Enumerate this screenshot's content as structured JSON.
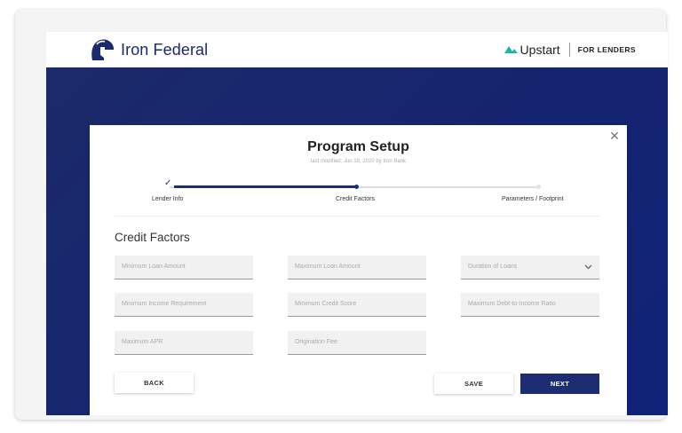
{
  "header": {
    "brand_name": "Iron Federal",
    "brand_icon": "spartan-helmet-icon",
    "partner_name": "Upstart",
    "partner_icon": "upstart-logo-icon",
    "partner_tagline": "FOR LENDERS"
  },
  "modal": {
    "title": "Program Setup",
    "subtitle": "last modified: Jun 19, 2020 by Iron Bank",
    "close_icon": "close-icon"
  },
  "stepper": {
    "steps": [
      {
        "label": "Lender Info",
        "status": "complete"
      },
      {
        "label": "Credit Factors",
        "status": "active"
      },
      {
        "label": "Parameters / Footprint",
        "status": "pending"
      }
    ],
    "progress_fraction": 0.5
  },
  "section": {
    "title": "Credit Factors"
  },
  "fields": {
    "min_loan_amount": {
      "placeholder": "Minimum Loan Amount",
      "value": ""
    },
    "max_loan_amount": {
      "placeholder": "Maximum Loan Amount",
      "value": ""
    },
    "duration_of_loans": {
      "placeholder": "Duration of Loans",
      "value": "",
      "type": "select"
    },
    "min_income": {
      "placeholder": "Minimum Income Requirement",
      "value": ""
    },
    "min_credit_score": {
      "placeholder": "Minimum Credit Score",
      "value": ""
    },
    "max_dti": {
      "placeholder": "Maximum Debt-to-Income Ratio",
      "value": ""
    },
    "max_apr": {
      "placeholder": "Maximum APR",
      "value": ""
    },
    "origination_fee": {
      "placeholder": "Origination Fee",
      "value": ""
    }
  },
  "actions": {
    "back_label": "BACK",
    "save_label": "SAVE",
    "next_label": "NEXT"
  },
  "colors": {
    "brand_navy": "#1c2d74",
    "hero_background": "#15246f",
    "upstart_teal": "#19b5a6",
    "field_background": "#f1f1f1"
  }
}
